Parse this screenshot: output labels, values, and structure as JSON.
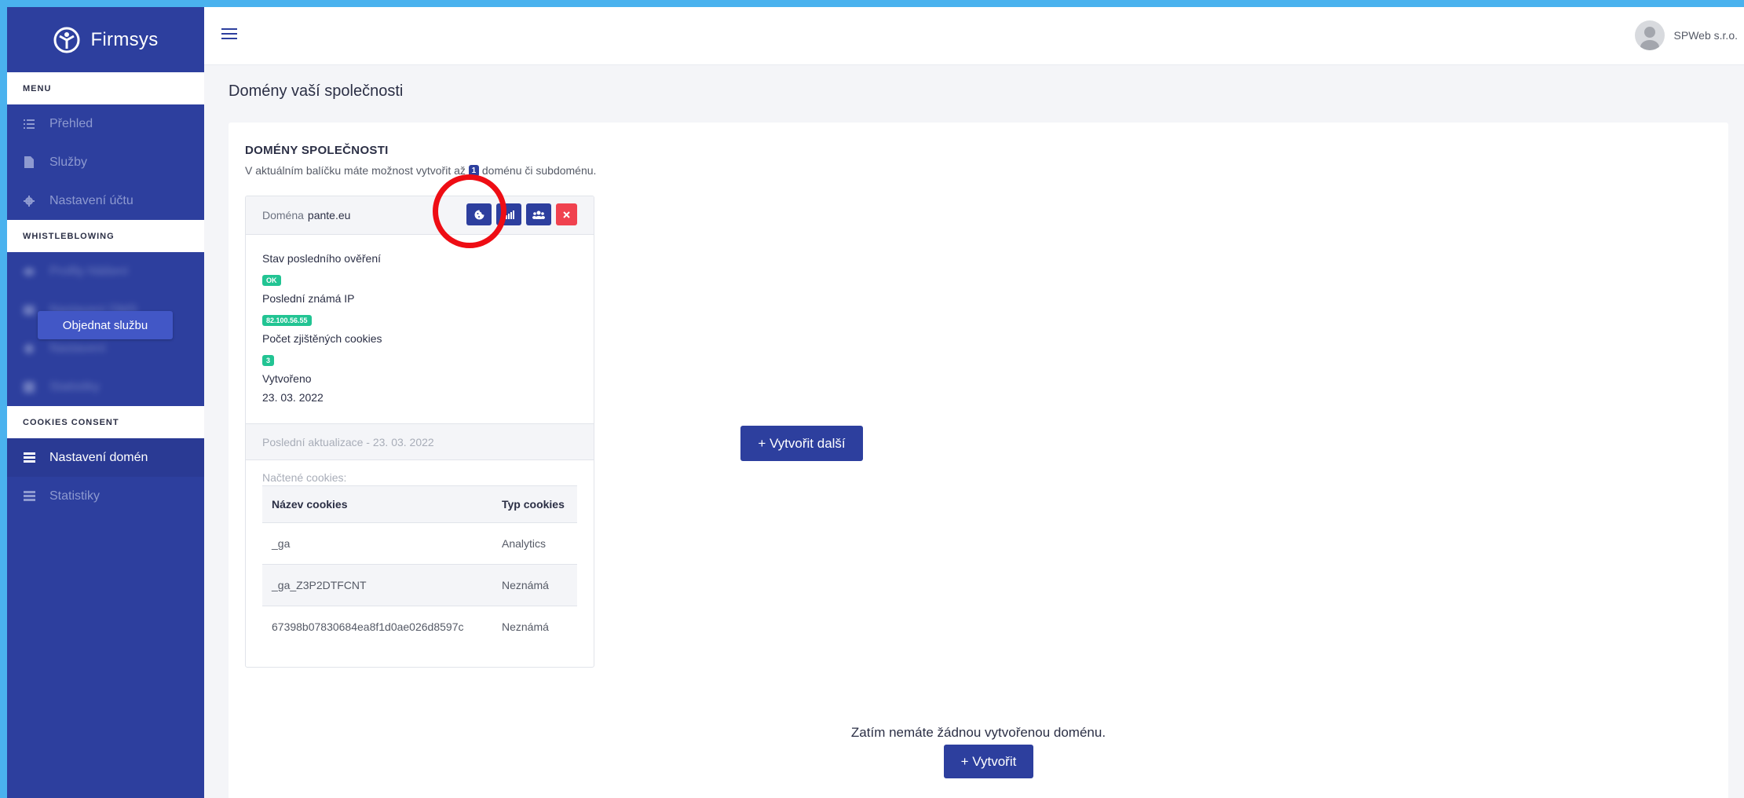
{
  "brand": {
    "name": "Firmsys"
  },
  "sidebar": {
    "sections": [
      {
        "header": "MENU",
        "items": [
          {
            "label": "Přehled",
            "icon": "list-icon",
            "active": false
          },
          {
            "label": "Služby",
            "icon": "document-icon",
            "active": false
          },
          {
            "label": "Nastavení účtu",
            "icon": "gear-icon",
            "active": false
          }
        ]
      },
      {
        "header": "WHISTLEBLOWING",
        "items": [
          {
            "label": "Profily hlášení",
            "icon": "eye-icon",
            "active": false
          },
          {
            "label": "Nastavení DMS",
            "icon": "folder-icon",
            "active": false
          },
          {
            "label": "Nastavení",
            "icon": "gear-icon",
            "active": false
          },
          {
            "label": "Statistiky",
            "icon": "chart-icon",
            "active": false
          }
        ],
        "overlay_button": "Objednat službu"
      },
      {
        "header": "COOKIES CONSENT",
        "items": [
          {
            "label": "Nastavení domén",
            "icon": "table-icon",
            "active": true
          },
          {
            "label": "Statistiky",
            "icon": "table-icon",
            "active": false
          }
        ]
      }
    ]
  },
  "topbar": {
    "user_name": "SPWeb s.r.o."
  },
  "page": {
    "title": "Domény vaší společnosti"
  },
  "section": {
    "title": "DOMÉNY SPOLEČNOSTI",
    "desc_before": "V aktuálním balíčku máte možnost vytvořit až",
    "desc_count": "1",
    "desc_after": "doménu či subdoménu."
  },
  "domain_card": {
    "label": "Doména",
    "domain": "pante.eu",
    "actions": [
      "cookie-settings",
      "statistics",
      "users",
      "delete"
    ],
    "fields": {
      "status_label": "Stav posledního ověření",
      "status_value": "OK",
      "ip_label": "Poslední známá IP",
      "ip_value": "82.100.56.55",
      "cookies_count_label": "Počet zjištěných cookies",
      "cookies_count_value": "3",
      "created_label": "Vytvořeno",
      "created_value": "23. 03. 2022"
    },
    "last_update": "Poslední aktualizace - 23. 03. 2022",
    "cookies_loaded_label": "Načtené cookies:",
    "table": {
      "columns": [
        "Název cookies",
        "Typ cookies"
      ],
      "rows": [
        {
          "name": "_ga",
          "type": "Analytics"
        },
        {
          "name": "_ga_Z3P2DTFCNT",
          "type": "Neznámá"
        },
        {
          "name": "67398b07830684ea8f1d0ae026d8597c",
          "type": "Neznámá"
        }
      ]
    }
  },
  "buttons": {
    "create_more": "+ Vytvořit další",
    "create": "+ Vytvořit"
  },
  "empty_message": "Zatím nemáte žádnou vytvořenou doménu.",
  "colors": {
    "primary": "#2d3f9e",
    "success": "#22c493",
    "danger": "#f0424f",
    "highlight": "#ee0d14"
  }
}
